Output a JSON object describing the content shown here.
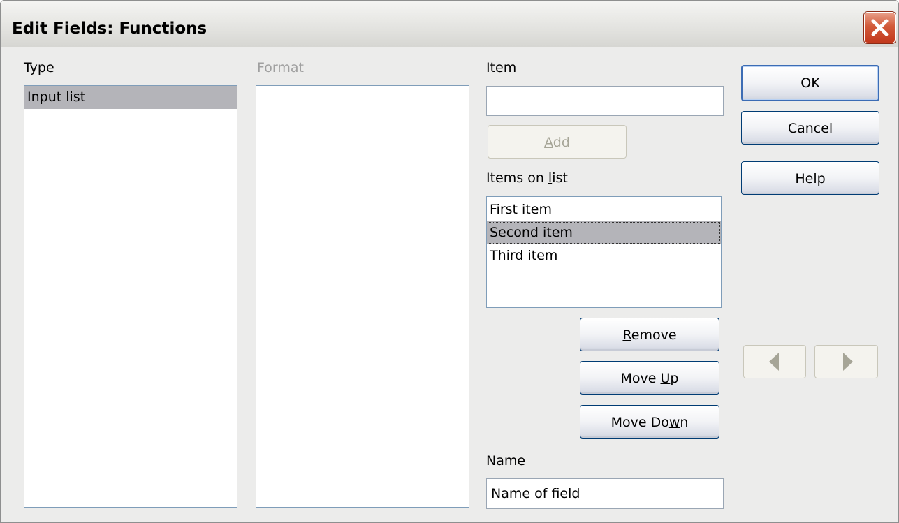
{
  "window": {
    "title": "Edit Fields: Functions"
  },
  "type_section": {
    "label_prefix": "",
    "label_mnemonic": "T",
    "label_suffix": "ype",
    "items": [
      "Input list"
    ]
  },
  "format_section": {
    "label_prefix": "F",
    "label_mnemonic": "o",
    "label_suffix": "rmat",
    "items": []
  },
  "item_section": {
    "label_prefix": "Ite",
    "label_mnemonic": "m",
    "label_suffix": "",
    "value": "",
    "add_button": {
      "prefix": "",
      "mnemonic": "A",
      "suffix": "dd"
    }
  },
  "items_on_list": {
    "label_prefix": "Items on ",
    "label_mnemonic": "l",
    "label_suffix": "ist",
    "items": [
      "First item",
      "Second item",
      "Third item"
    ],
    "selected_index": 1
  },
  "list_buttons": {
    "remove": {
      "prefix": "",
      "mnemonic": "R",
      "suffix": "emove"
    },
    "move_up": {
      "prefix": "Move ",
      "mnemonic": "U",
      "suffix": "p"
    },
    "move_down": {
      "prefix": "Move Do",
      "mnemonic": "w",
      "suffix": "n"
    }
  },
  "name_section": {
    "label_prefix": "Na",
    "label_mnemonic": "m",
    "label_suffix": "e",
    "value": "Name of field"
  },
  "dialog_buttons": {
    "ok": "OK",
    "cancel": "Cancel",
    "help": {
      "prefix": "",
      "mnemonic": "H",
      "suffix": "elp"
    }
  },
  "colors": {
    "selection": "#b4b4b9",
    "button_border": "#003c74",
    "default_button_border": "#3c6cb4",
    "close_button": "#c2391d"
  },
  "icons": {
    "close": "close-icon",
    "previous": "arrow-left-icon",
    "next": "arrow-right-icon"
  }
}
